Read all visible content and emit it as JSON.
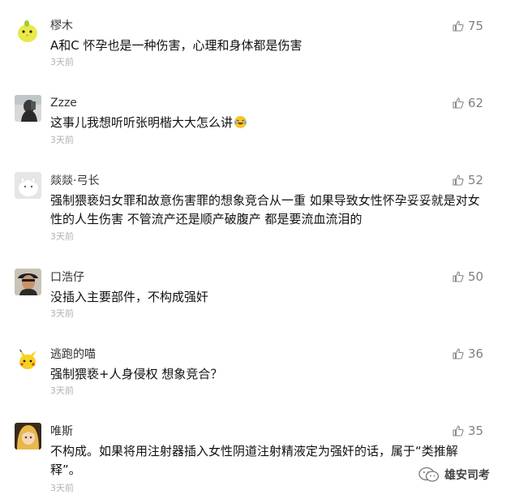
{
  "colors": {
    "like_icon": "#888888",
    "time": "#b2b2b2",
    "name": "#333333"
  },
  "comments": [
    {
      "name": "樛木",
      "content": "A和C  怀孕也是一种伤害，心理和身体都是伤害",
      "time": "3天前",
      "likes": "75",
      "avatar_icon": "yellow-bird-avatar"
    },
    {
      "name": "Zzze",
      "content": "这事儿我想听听张明楷大大怎么讲",
      "time": "3天前",
      "likes": "62",
      "avatar_icon": "dark-figure-avatar",
      "emoji": "laugh-cry-emoji"
    },
    {
      "name": "燚燚·弓长",
      "content": "强制猥亵妇女罪和故意伤害罪的想象竞合从一重 如果导致女性怀孕妥妥就是对女性的人生伤害 不管流产还是顺产破腹产 都是要流血流泪的",
      "time": "3天前",
      "likes": "52",
      "avatar_icon": "white-cat-avatar"
    },
    {
      "name": "口浩仔",
      "content": "没插入主要部件，不构成强奸",
      "time": "3天前",
      "likes": "50",
      "avatar_icon": "man-hat-avatar"
    },
    {
      "name": "逃跑的喵",
      "content": "强制猥亵+人身侵权 想象竞合？",
      "time": "3天前",
      "likes": "36",
      "avatar_icon": "pikachu-avatar"
    },
    {
      "name": "唯斯",
      "content": "不构成。如果将用注射器插入女性阴道注射精液定为强奸的话，属于“类推解释”。",
      "time": "3天前",
      "likes": "35",
      "avatar_icon": "anime-girl-avatar"
    }
  ],
  "watermark": {
    "text": "雄安司考",
    "icon": "wechat-logo-icon"
  }
}
